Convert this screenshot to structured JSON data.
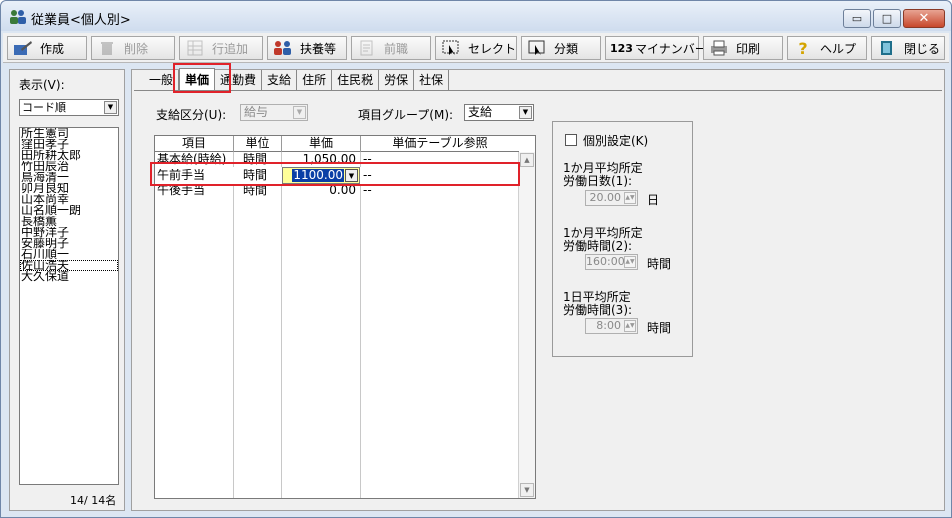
{
  "window": {
    "title": "従業員<個人別>",
    "min_glyph": "▭",
    "max_glyph": "□",
    "close_glyph": "✕"
  },
  "toolbar": {
    "create": "作成",
    "delete": "削除",
    "add_row": "行追加",
    "dependents": "扶養等",
    "prev_job": "前職",
    "select": "セレクト",
    "classify": "分類",
    "mynumber": "マイナンバー",
    "print": "印刷",
    "help": "ヘルプ",
    "close": "閉じる",
    "mynumber_icon_text": "123"
  },
  "left": {
    "display_label": "表示(V):",
    "order_value": "コード順",
    "employees": [
      "所生憲司",
      "窪田孝子",
      "田所耕太郎",
      "竹田辰治",
      "鳥海清一",
      "卯月良知",
      "山本尚幸",
      "山名順一朗",
      "長橋薫",
      "中野洋子",
      "安藤明子",
      "石川順一",
      "佐山浩夫",
      "大久保道"
    ],
    "count": "14/ 14名"
  },
  "tabs": [
    "一般",
    "単価",
    "通勤費",
    "支給",
    "住所",
    "住民税",
    "労保",
    "社保"
  ],
  "active_tab": "単価",
  "form": {
    "pay_class_label": "支給区分(U):",
    "pay_class_value": "給与",
    "item_group_label": "項目グループ(M):",
    "item_group_value": "支給"
  },
  "grid": {
    "headers": [
      "項目",
      "単位",
      "単価",
      "単価テーブル参照"
    ],
    "rows": [
      {
        "item": "基本給(時給)",
        "unit": "時間",
        "price": "1,050.00",
        "ref": "--"
      },
      {
        "item": "午前手当",
        "unit": "時間",
        "price": "1100.00",
        "ref": "--"
      },
      {
        "item": "午後手当",
        "unit": "時間",
        "price": "0.00",
        "ref": "--"
      }
    ]
  },
  "settings": {
    "individual_label": "個別設定(K)",
    "days_label_1": "1か月平均所定",
    "days_label_2": "労働日数(1):",
    "days_value": "20.00",
    "days_unit": "日",
    "hours_label_1": "1か月平均所定",
    "hours_label_2": "労働時間(2):",
    "hours_value": "160:00",
    "hours_unit": "時間",
    "daily_label_1": "1日平均所定",
    "daily_label_2": "労働時間(3):",
    "daily_value": "8:00",
    "daily_unit": "時間"
  },
  "colors": {
    "highlight_red": "#e0222a",
    "edit_yellow": "#ffff99",
    "selection_blue": "#0a3fa6"
  }
}
